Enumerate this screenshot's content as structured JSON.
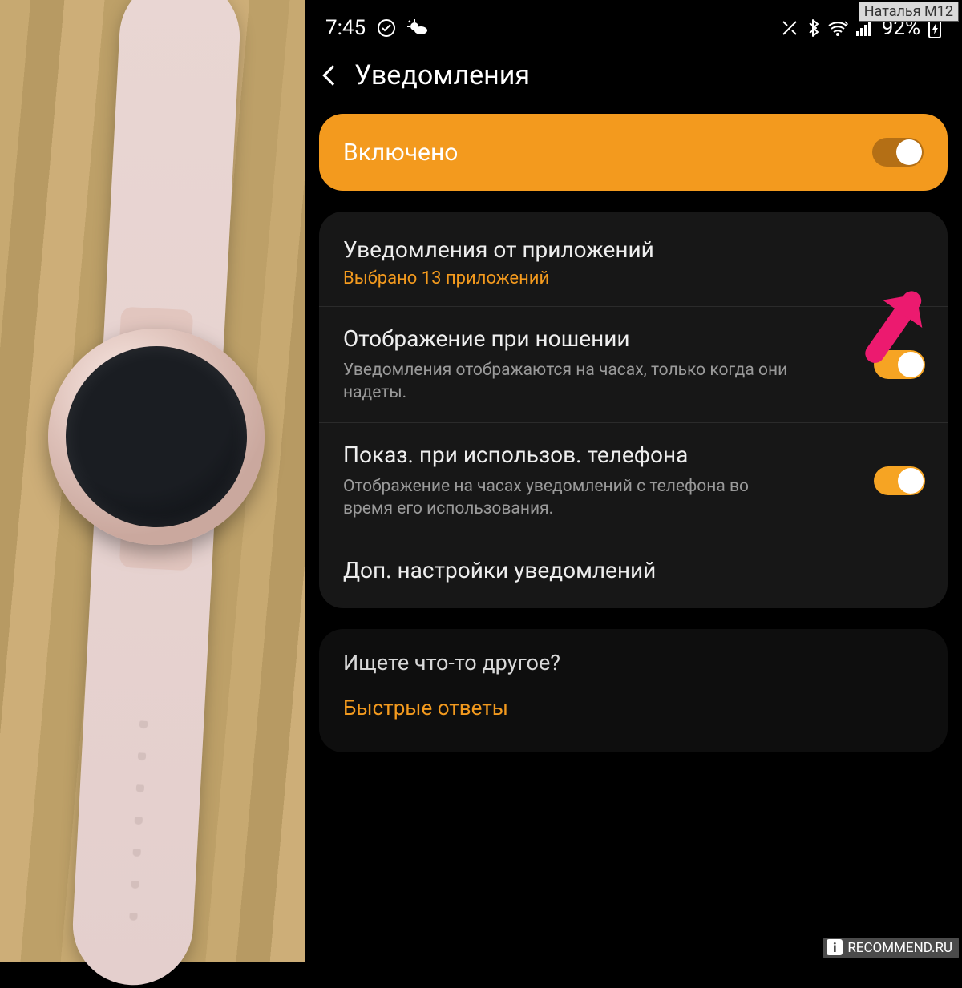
{
  "watermark": {
    "user": "Наталья М12",
    "site": "RECOMMEND.RU",
    "site_icon_letter": "i"
  },
  "statusbar": {
    "time": "7:45",
    "battery": "92%"
  },
  "header": {
    "title": "Уведомления"
  },
  "enabled_card": {
    "label": "Включено",
    "state": "on"
  },
  "settings": [
    {
      "title": "Уведомления от приложений",
      "accent": "Выбрано 13 приложений",
      "toggle": null
    },
    {
      "title": "Отображение при ношении",
      "sub": "Уведомления отображаются на часах, только когда они надеты.",
      "toggle": "on"
    },
    {
      "title": "Показ. при использов. телефона",
      "sub": "Отображение на часах уведомлений с телефона во время его использования.",
      "toggle": "on"
    },
    {
      "title": "Доп. настройки уведомлений",
      "toggle": null
    }
  ],
  "footer": {
    "question": "Ищете что-то другое?",
    "link": "Быстрые ответы"
  },
  "colors": {
    "accent": "#f39a1e",
    "arrow": "#e91e63"
  }
}
